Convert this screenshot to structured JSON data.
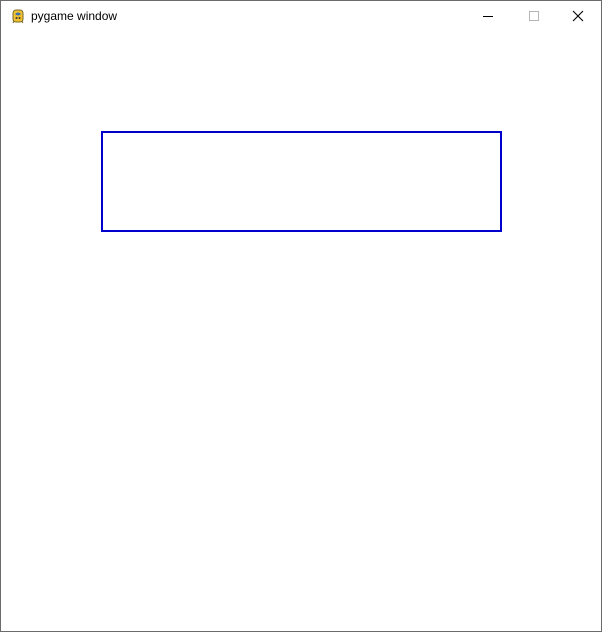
{
  "window": {
    "title": "pygame window",
    "icon": "pygame-snake-icon",
    "controls": {
      "minimize": "minimize-icon",
      "maximize": "maximize-icon",
      "close": "close-icon"
    }
  },
  "canvas": {
    "background": "#ffffff",
    "rectangle": {
      "stroke": "#0000cc",
      "fill": "none"
    }
  }
}
